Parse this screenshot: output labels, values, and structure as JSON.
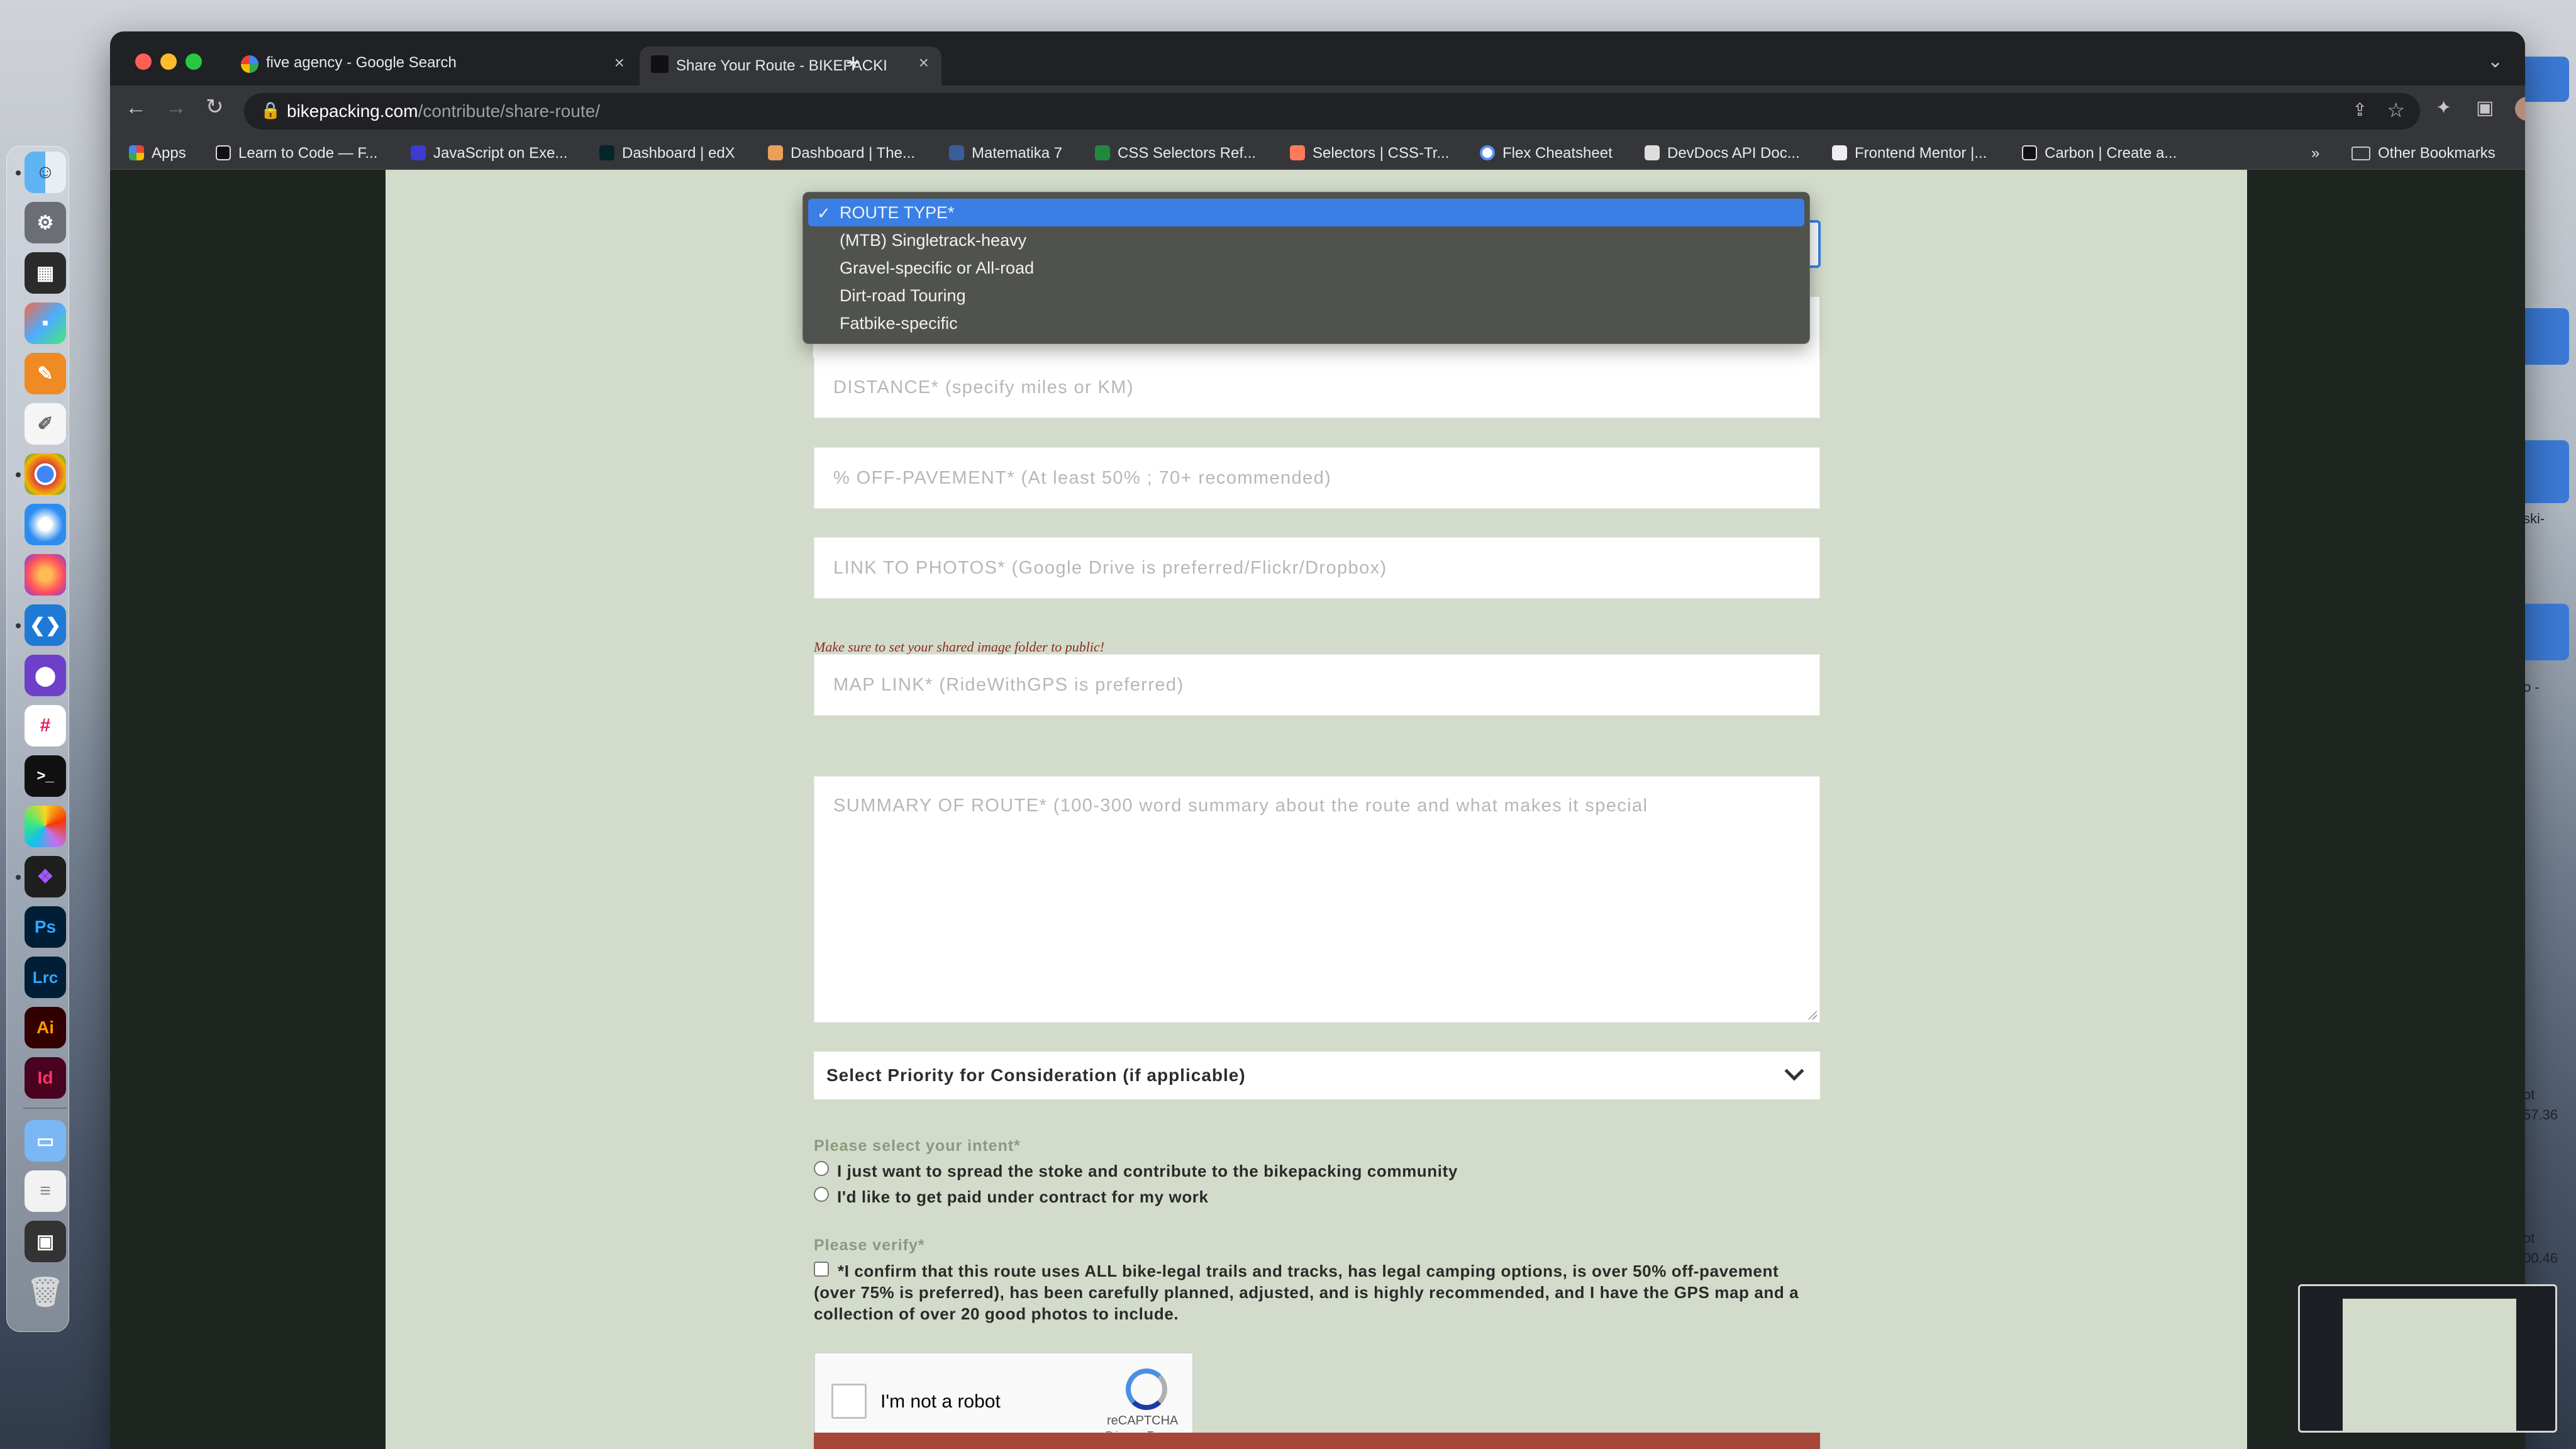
{
  "window": {
    "tabs": [
      {
        "title": "five agency - Google Search",
        "active": false
      },
      {
        "title": "Share Your Route - BIKEPACKI",
        "active": true
      }
    ],
    "url_host": "bikepacking.com",
    "url_path": "/contribute/share-route/"
  },
  "bookmarks": [
    "Apps",
    "Learn to Code — F...",
    "JavaScript on Exe...",
    "Dashboard | edX",
    "Dashboard | The...",
    "Matematika 7",
    "CSS Selectors Ref...",
    "Selectors | CSS-Tr...",
    "Flex Cheatsheet",
    "DevDocs API Doc...",
    "Frontend Mentor |...",
    "Carbon | Create a..."
  ],
  "bookmarks_overflow": "»",
  "other_bookmarks": "Other Bookmarks",
  "form": {
    "route_type_options": [
      "ROUTE TYPE*",
      "(MTB) Singletrack-heavy",
      "Gravel-specific or All-road",
      "Dirt-road Touring",
      "Fatbike-specific"
    ],
    "distance_placeholder": "DISTANCE* (specify miles or KM)",
    "offpavement_placeholder": "% OFF-PAVEMENT* (At least 50% ; 70+ recommended)",
    "photos_placeholder": "LINK TO PHOTOS* (Google Drive is preferred/Flickr/Dropbox)",
    "photos_helper": "Make sure to set your shared image folder to public!",
    "map_placeholder": "MAP LINK* (RideWithGPS is preferred)",
    "summary_placeholder": "SUMMARY OF ROUTE* (100-300 word summary about the route and what makes it special",
    "priority_select": "Select Priority for Consideration (if applicable)",
    "intent_label": "Please select your intent*",
    "intent_options": [
      "I just want to spread the stoke and contribute to the bikepacking community",
      "I'd like to get paid under contract for my work"
    ],
    "verify_label": "Please verify*",
    "verify_text": "*I confirm that this route uses ALL bike-legal trails and tracks, has legal camping options, is over 50% off-pavement (over 75% is preferred), has been carefully planned, adjusted, and is highly recommended, and I have the GPS map and a collection of over 20 good photos to include.",
    "recaptcha": {
      "label": "I'm not a robot",
      "brand": "reCAPTCHA",
      "links": "Privacy - Terms"
    }
  },
  "desktop_fragments": [
    "ski-",
    "o -",
    "ot",
    "57.36",
    "ot",
    "00.46"
  ]
}
